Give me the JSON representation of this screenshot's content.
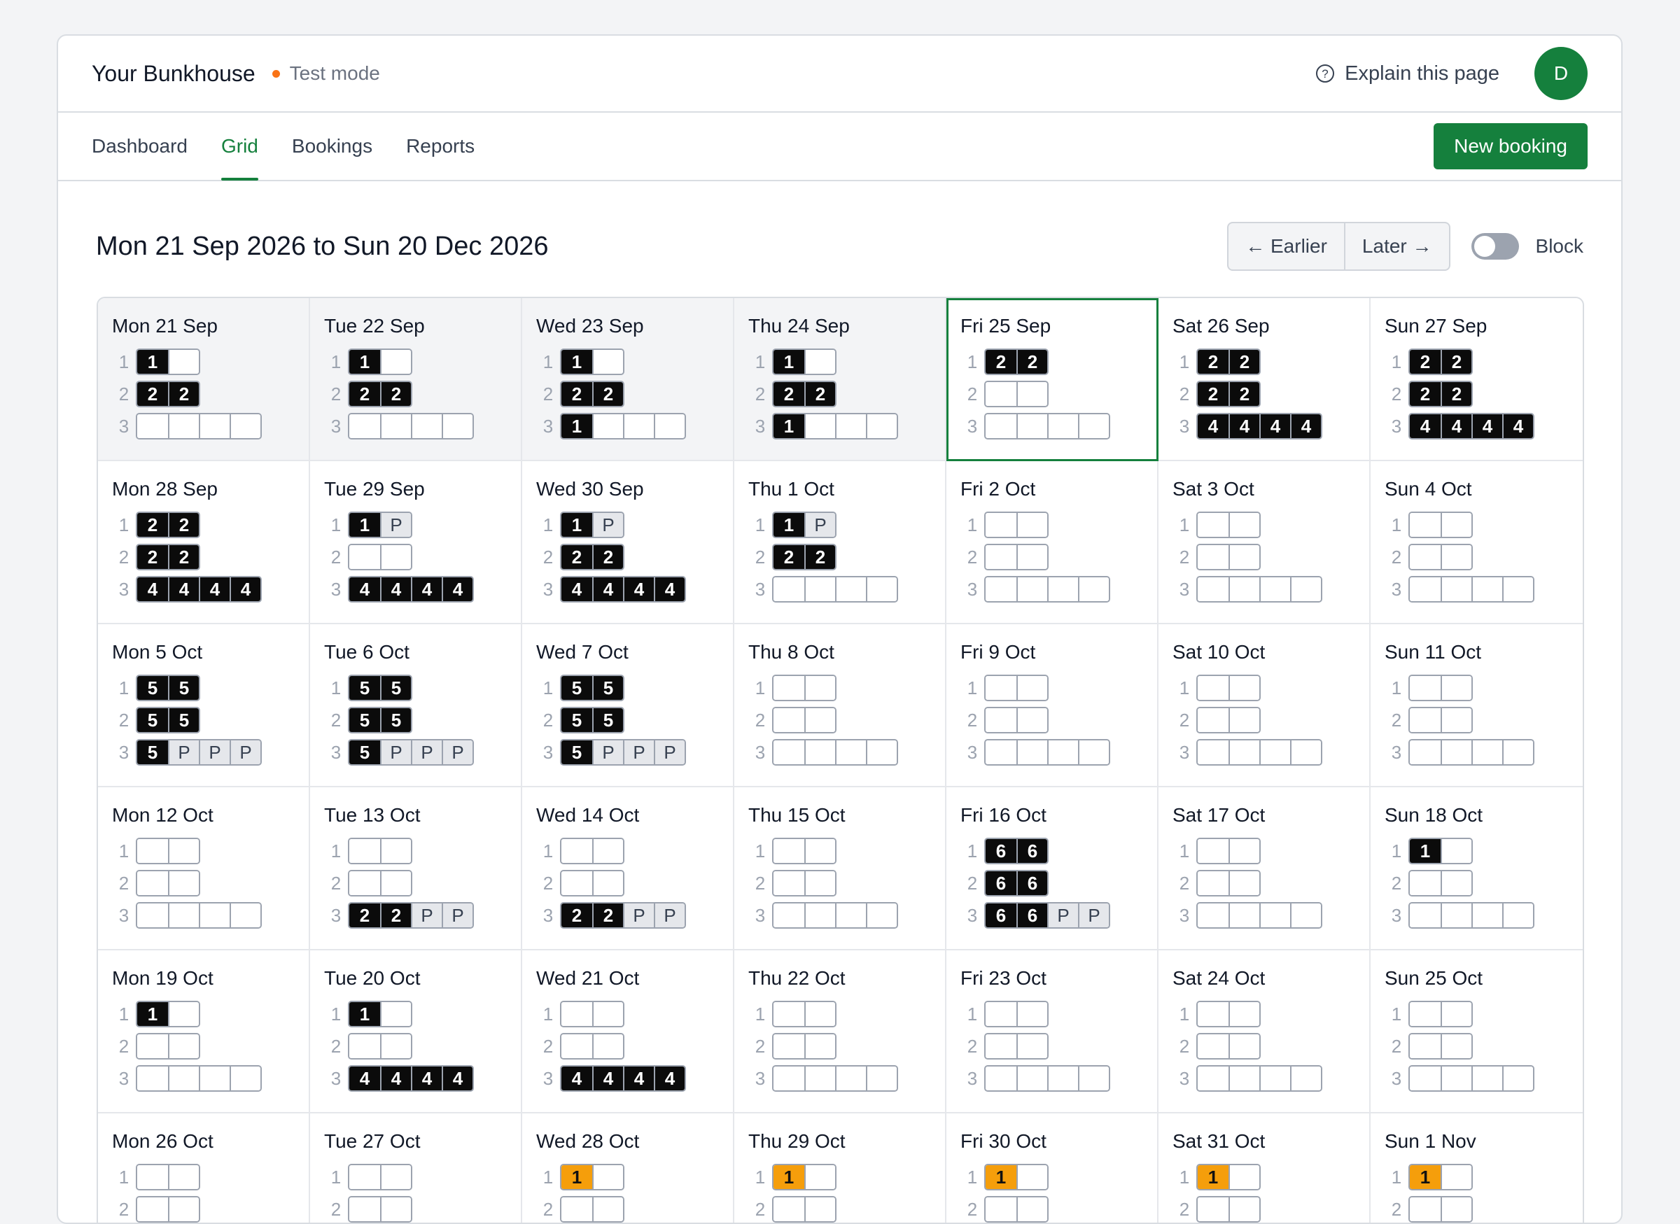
{
  "header": {
    "brand": "Your Bunkhouse",
    "mode": "Test mode",
    "explain_label": "Explain this page",
    "avatar_initial": "D"
  },
  "nav": {
    "tabs": [
      "Dashboard",
      "Grid",
      "Bookings",
      "Reports"
    ],
    "active": "Grid",
    "new_booking_label": "New booking"
  },
  "toolbar": {
    "range_title": "Mon 21 Sep 2026 to Sun 20 Dec 2026",
    "earlier_label": "← Earlier",
    "later_label": "Later →",
    "block_label": "Block",
    "block_on": false
  },
  "colors": {
    "accent": "#15803d",
    "booked": "#0b0b0b",
    "provisional": "#e5e7eb",
    "highlight": "#f59e0b",
    "test_dot": "#f97316"
  },
  "rooms": [
    "1",
    "2",
    "3"
  ],
  "days": [
    {
      "label": "Mon 21 Sep",
      "past": true,
      "rooms": [
        [
          "b:1",
          ""
        ],
        [
          "b:2",
          "b:2"
        ],
        [
          "",
          "",
          "",
          ""
        ]
      ]
    },
    {
      "label": "Tue 22 Sep",
      "past": true,
      "rooms": [
        [
          "b:1",
          ""
        ],
        [
          "b:2",
          "b:2"
        ],
        [
          "",
          "",
          "",
          ""
        ]
      ]
    },
    {
      "label": "Wed 23 Sep",
      "past": true,
      "rooms": [
        [
          "b:1",
          ""
        ],
        [
          "b:2",
          "b:2"
        ],
        [
          "b:1",
          "",
          "",
          ""
        ]
      ]
    },
    {
      "label": "Thu 24 Sep",
      "past": true,
      "rooms": [
        [
          "b:1",
          ""
        ],
        [
          "b:2",
          "b:2"
        ],
        [
          "b:1",
          "",
          "",
          ""
        ]
      ]
    },
    {
      "label": "Fri 25 Sep",
      "today": true,
      "rooms": [
        [
          "b:2",
          "b:2"
        ],
        [
          "",
          ""
        ],
        [
          "",
          "",
          "",
          ""
        ]
      ]
    },
    {
      "label": "Sat 26 Sep",
      "rooms": [
        [
          "b:2",
          "b:2"
        ],
        [
          "b:2",
          "b:2"
        ],
        [
          "b:4",
          "b:4",
          "b:4",
          "b:4"
        ]
      ]
    },
    {
      "label": "Sun 27 Sep",
      "rooms": [
        [
          "b:2",
          "b:2"
        ],
        [
          "b:2",
          "b:2"
        ],
        [
          "b:4",
          "b:4",
          "b:4",
          "b:4"
        ]
      ]
    },
    {
      "label": "Mon 28 Sep",
      "rooms": [
        [
          "b:2",
          "b:2"
        ],
        [
          "b:2",
          "b:2"
        ],
        [
          "b:4",
          "b:4",
          "b:4",
          "b:4"
        ]
      ]
    },
    {
      "label": "Tue 29 Sep",
      "rooms": [
        [
          "b:1",
          "p:P"
        ],
        [
          "",
          ""
        ],
        [
          "b:4",
          "b:4",
          "b:4",
          "b:4"
        ]
      ]
    },
    {
      "label": "Wed 30 Sep",
      "rooms": [
        [
          "b:1",
          "p:P"
        ],
        [
          "b:2",
          "b:2"
        ],
        [
          "b:4",
          "b:4",
          "b:4",
          "b:4"
        ]
      ]
    },
    {
      "label": "Thu 1 Oct",
      "rooms": [
        [
          "b:1",
          "p:P"
        ],
        [
          "b:2",
          "b:2"
        ],
        [
          "",
          "",
          "",
          ""
        ]
      ]
    },
    {
      "label": "Fri 2 Oct",
      "rooms": [
        [
          "",
          ""
        ],
        [
          "",
          ""
        ],
        [
          "",
          "",
          "",
          ""
        ]
      ]
    },
    {
      "label": "Sat 3 Oct",
      "rooms": [
        [
          "",
          ""
        ],
        [
          "",
          ""
        ],
        [
          "",
          "",
          "",
          ""
        ]
      ]
    },
    {
      "label": "Sun 4 Oct",
      "rooms": [
        [
          "",
          ""
        ],
        [
          "",
          ""
        ],
        [
          "",
          "",
          "",
          ""
        ]
      ]
    },
    {
      "label": "Mon 5 Oct",
      "rooms": [
        [
          "b:5",
          "b:5"
        ],
        [
          "b:5",
          "b:5"
        ],
        [
          "b:5",
          "p:P",
          "p:P",
          "p:P"
        ]
      ]
    },
    {
      "label": "Tue 6 Oct",
      "rooms": [
        [
          "b:5",
          "b:5"
        ],
        [
          "b:5",
          "b:5"
        ],
        [
          "b:5",
          "p:P",
          "p:P",
          "p:P"
        ]
      ]
    },
    {
      "label": "Wed 7 Oct",
      "rooms": [
        [
          "b:5",
          "b:5"
        ],
        [
          "b:5",
          "b:5"
        ],
        [
          "b:5",
          "p:P",
          "p:P",
          "p:P"
        ]
      ]
    },
    {
      "label": "Thu 8 Oct",
      "rooms": [
        [
          "",
          ""
        ],
        [
          "",
          ""
        ],
        [
          "",
          "",
          "",
          ""
        ]
      ]
    },
    {
      "label": "Fri 9 Oct",
      "rooms": [
        [
          "",
          ""
        ],
        [
          "",
          ""
        ],
        [
          "",
          "",
          "",
          ""
        ]
      ]
    },
    {
      "label": "Sat 10 Oct",
      "rooms": [
        [
          "",
          ""
        ],
        [
          "",
          ""
        ],
        [
          "",
          "",
          "",
          ""
        ]
      ]
    },
    {
      "label": "Sun 11 Oct",
      "rooms": [
        [
          "",
          ""
        ],
        [
          "",
          ""
        ],
        [
          "",
          "",
          "",
          ""
        ]
      ]
    },
    {
      "label": "Mon 12 Oct",
      "rooms": [
        [
          "",
          ""
        ],
        [
          "",
          ""
        ],
        [
          "",
          "",
          "",
          ""
        ]
      ]
    },
    {
      "label": "Tue 13 Oct",
      "rooms": [
        [
          "",
          ""
        ],
        [
          "",
          ""
        ],
        [
          "b:2",
          "b:2",
          "p:P",
          "p:P"
        ]
      ]
    },
    {
      "label": "Wed 14 Oct",
      "rooms": [
        [
          "",
          ""
        ],
        [
          "",
          ""
        ],
        [
          "b:2",
          "b:2",
          "p:P",
          "p:P"
        ]
      ]
    },
    {
      "label": "Thu 15 Oct",
      "rooms": [
        [
          "",
          ""
        ],
        [
          "",
          ""
        ],
        [
          "",
          "",
          "",
          ""
        ]
      ]
    },
    {
      "label": "Fri 16 Oct",
      "rooms": [
        [
          "b:6",
          "b:6"
        ],
        [
          "b:6",
          "b:6"
        ],
        [
          "b:6",
          "b:6",
          "p:P",
          "p:P"
        ]
      ]
    },
    {
      "label": "Sat 17 Oct",
      "rooms": [
        [
          "",
          ""
        ],
        [
          "",
          ""
        ],
        [
          "",
          "",
          "",
          ""
        ]
      ]
    },
    {
      "label": "Sun 18 Oct",
      "rooms": [
        [
          "b:1",
          ""
        ],
        [
          "",
          ""
        ],
        [
          "",
          "",
          "",
          ""
        ]
      ]
    },
    {
      "label": "Mon 19 Oct",
      "rooms": [
        [
          "b:1",
          ""
        ],
        [
          "",
          ""
        ],
        [
          "",
          "",
          "",
          ""
        ]
      ]
    },
    {
      "label": "Tue 20 Oct",
      "rooms": [
        [
          "b:1",
          ""
        ],
        [
          "",
          ""
        ],
        [
          "b:4",
          "b:4",
          "b:4",
          "b:4"
        ]
      ]
    },
    {
      "label": "Wed 21 Oct",
      "rooms": [
        [
          "",
          ""
        ],
        [
          "",
          ""
        ],
        [
          "b:4",
          "b:4",
          "b:4",
          "b:4"
        ]
      ]
    },
    {
      "label": "Thu 22 Oct",
      "rooms": [
        [
          "",
          ""
        ],
        [
          "",
          ""
        ],
        [
          "",
          "",
          "",
          ""
        ]
      ]
    },
    {
      "label": "Fri 23 Oct",
      "rooms": [
        [
          "",
          ""
        ],
        [
          "",
          ""
        ],
        [
          "",
          "",
          "",
          ""
        ]
      ]
    },
    {
      "label": "Sat 24 Oct",
      "rooms": [
        [
          "",
          ""
        ],
        [
          "",
          ""
        ],
        [
          "",
          "",
          "",
          ""
        ]
      ]
    },
    {
      "label": "Sun 25 Oct",
      "rooms": [
        [
          "",
          ""
        ],
        [
          "",
          ""
        ],
        [
          "",
          "",
          "",
          ""
        ]
      ]
    },
    {
      "label": "Mon 26 Oct",
      "rooms": [
        [
          "",
          ""
        ],
        [
          "",
          ""
        ],
        [
          "",
          "",
          "",
          ""
        ]
      ]
    },
    {
      "label": "Tue 27 Oct",
      "rooms": [
        [
          "",
          ""
        ],
        [
          "",
          ""
        ],
        [
          "",
          "",
          "",
          ""
        ]
      ]
    },
    {
      "label": "Wed 28 Oct",
      "rooms": [
        [
          "o:1",
          ""
        ],
        [
          "",
          ""
        ],
        [
          "",
          "",
          "",
          ""
        ]
      ]
    },
    {
      "label": "Thu 29 Oct",
      "rooms": [
        [
          "o:1",
          ""
        ],
        [
          "",
          ""
        ],
        [
          "",
          "",
          "",
          ""
        ]
      ]
    },
    {
      "label": "Fri 30 Oct",
      "rooms": [
        [
          "o:1",
          ""
        ],
        [
          "",
          ""
        ],
        [
          "",
          "",
          "",
          ""
        ]
      ]
    },
    {
      "label": "Sat 31 Oct",
      "rooms": [
        [
          "o:1",
          ""
        ],
        [
          "",
          ""
        ],
        [
          "",
          "",
          "",
          ""
        ]
      ]
    },
    {
      "label": "Sun 1 Nov",
      "rooms": [
        [
          "o:1",
          ""
        ],
        [
          "",
          ""
        ],
        [
          "",
          "",
          "",
          ""
        ]
      ]
    }
  ]
}
